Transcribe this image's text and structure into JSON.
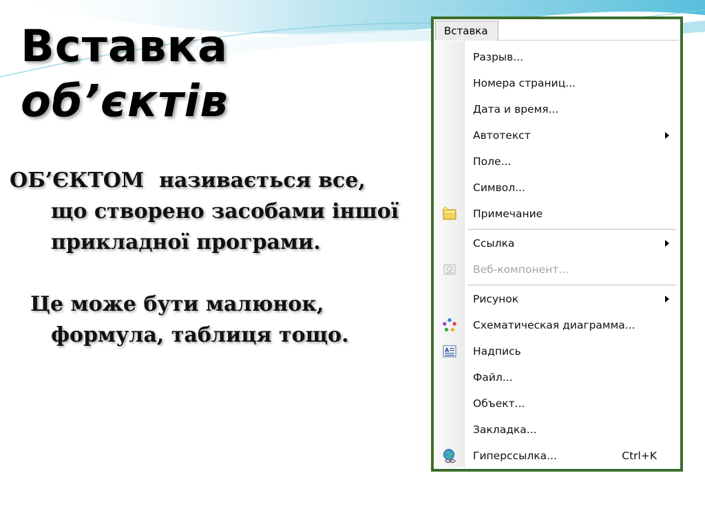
{
  "slide": {
    "title_line1": "Вставка",
    "title_line2": "об’єктів",
    "para1_term": "ОБ’ЄКТОМ",
    "para1_text": "називається все, що створено засобами іншої прикладної програми.",
    "para2_text": "Це може бути малюнок, формула, таблиця тощо."
  },
  "menu": {
    "title": "Вставка",
    "items": [
      {
        "label": "Разрыв..."
      },
      {
        "label": "Номера страниц..."
      },
      {
        "label": "Дата и время..."
      },
      {
        "label": "Автотекст"
      },
      {
        "label": "Поле..."
      },
      {
        "label": "Символ..."
      },
      {
        "label": "Примечание",
        "icon": "note-icon"
      },
      {
        "label": "Ссылка"
      },
      {
        "label": "Веб-компонент...",
        "icon": "web-component-icon"
      },
      {
        "label": "Рисунок"
      },
      {
        "label": "Схематическая диаграмма...",
        "icon": "diagram-icon"
      },
      {
        "label": "Надпись",
        "icon": "text-box-icon"
      },
      {
        "label": "Файл..."
      },
      {
        "label": "Объект..."
      },
      {
        "label": "Закладка..."
      },
      {
        "label": "Гиперссылка...",
        "icon": "hyperlink-icon",
        "shortcut": "Ctrl+K"
      }
    ]
  },
  "colors": {
    "frame": "#3c6e2a",
    "wave_dark": "#4bb6d6",
    "wave_light": "#cdebf4"
  }
}
